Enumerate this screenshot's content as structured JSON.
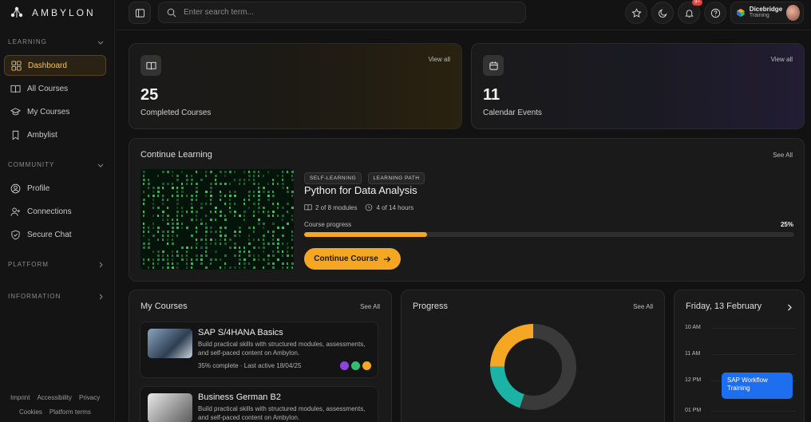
{
  "app": {
    "logo_text": "AMBYLON"
  },
  "sidebar": {
    "sections": [
      {
        "label": "LEARNING"
      },
      {
        "label": "COMMUNITY"
      },
      {
        "label": "PLATFORM"
      },
      {
        "label": "INFORMATION"
      }
    ],
    "items": [
      {
        "label": "Dashboard",
        "icon": "grid-icon",
        "active": true
      },
      {
        "label": "All Courses",
        "icon": "book-open-icon"
      },
      {
        "label": "My Courses",
        "icon": "graduation-cap-icon"
      },
      {
        "label": "Ambylist",
        "icon": "bookmark-icon"
      },
      {
        "label": "Profile",
        "icon": "user-circle-icon"
      },
      {
        "label": "Connections",
        "icon": "user-plus-icon"
      },
      {
        "label": "Secure Chat",
        "icon": "shield-icon"
      }
    ],
    "footer": {
      "links_row1": [
        "Imprint",
        "Accessibility",
        "Privacy"
      ],
      "links_row2": [
        "Cookies",
        "Platform terms"
      ]
    }
  },
  "topbar": {
    "search_placeholder": "Enter search term...",
    "notification_badge": "9+",
    "org_name": "Dicebridge",
    "org_sub": "Training"
  },
  "stats": [
    {
      "value": "25",
      "label": "Completed Courses",
      "link": "View all",
      "icon": "book-open-icon"
    },
    {
      "value": "11",
      "label": "Calendar Events",
      "link": "View all",
      "icon": "calendar-icon"
    }
  ],
  "continue_learning": {
    "title": "Continue Learning",
    "see_all": "See All",
    "tags": [
      "SELF-LEARNING",
      "LEARNING PATH"
    ],
    "course_title": "Python for Data Analysis",
    "modules": "2 of 8 modules",
    "hours": "4 of 14 hours",
    "progress_label": "Course progress",
    "progress_text": "25%",
    "progress_value": 0.25,
    "button_label": "Continue Course"
  },
  "my_courses": {
    "title": "My Courses",
    "see_all": "See All",
    "items": [
      {
        "title": "SAP S/4HANA Basics",
        "desc": "Build practical skills with structured modules, assessments, and self-paced content on Ambylon.",
        "meta": "35% complete  ·  Last active 18/04/25"
      },
      {
        "title": "Business German B2",
        "desc": "Build practical skills with structured modules, assessments, and self-paced content on Ambylon.",
        "meta": ""
      }
    ],
    "dot_colors": [
      "#8e44e0",
      "#2fbf71",
      "#f5a623"
    ]
  },
  "progress": {
    "title": "Progress",
    "see_all": "See All",
    "segments": [
      {
        "color": "#3a3a3a",
        "value": 55
      },
      {
        "color": "#1bb3a6",
        "value": 20
      },
      {
        "color": "#f5a623",
        "value": 25
      }
    ]
  },
  "calendar": {
    "date": "Friday, 13 February",
    "times": [
      "10 AM",
      "11 AM",
      "12 PM",
      "01 PM"
    ],
    "event": "SAP Workflow Training"
  },
  "colors": {
    "accent": "#f5a623",
    "event_blue": "#1e6ff0",
    "teal": "#1bb3a6"
  }
}
